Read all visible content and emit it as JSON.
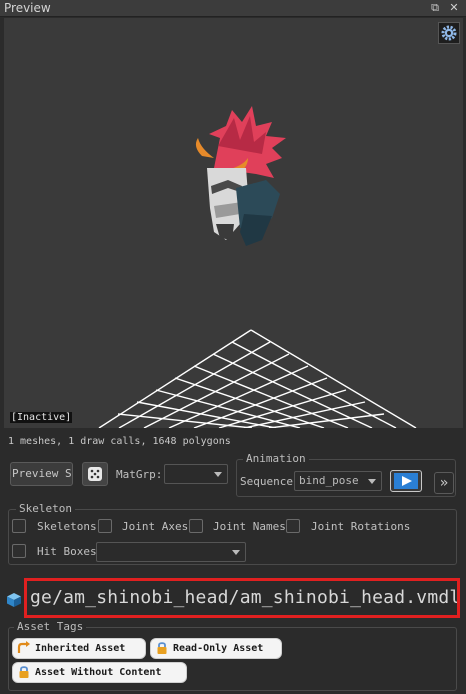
{
  "window": {
    "title": "Preview"
  },
  "viewport": {
    "status_label": "[Inactive]",
    "stats": "1 meshes, 1 draw calls, 1648 polygons"
  },
  "controls": {
    "preview_button": "Preview St",
    "matgrp_label": "MatGrp:",
    "matgrp_value": ""
  },
  "animation": {
    "title": "Animation",
    "sequence_label": "Sequence",
    "sequence_value": "bind_pose",
    "more_button": "»"
  },
  "skeleton": {
    "title": "Skeleton",
    "options": [
      "Skeletons",
      "Joint Axes",
      "Joint Names",
      "Joint Rotations"
    ],
    "hitboxes_label": "Hit Boxes",
    "hitboxes_value": ""
  },
  "asset": {
    "path": "ge/am_shinobi_head/am_shinobi_head.vmdl",
    "tags_title": "Asset Tags",
    "tags": [
      "Inherited Asset",
      "Read-Only Asset",
      "Asset Without Content"
    ]
  },
  "colors": {
    "background": "#2b2b2b",
    "viewport": "#3a3a3a",
    "highlight": "#e02020",
    "play_accent": "#2a7fd4",
    "hair": "#e0405a"
  }
}
